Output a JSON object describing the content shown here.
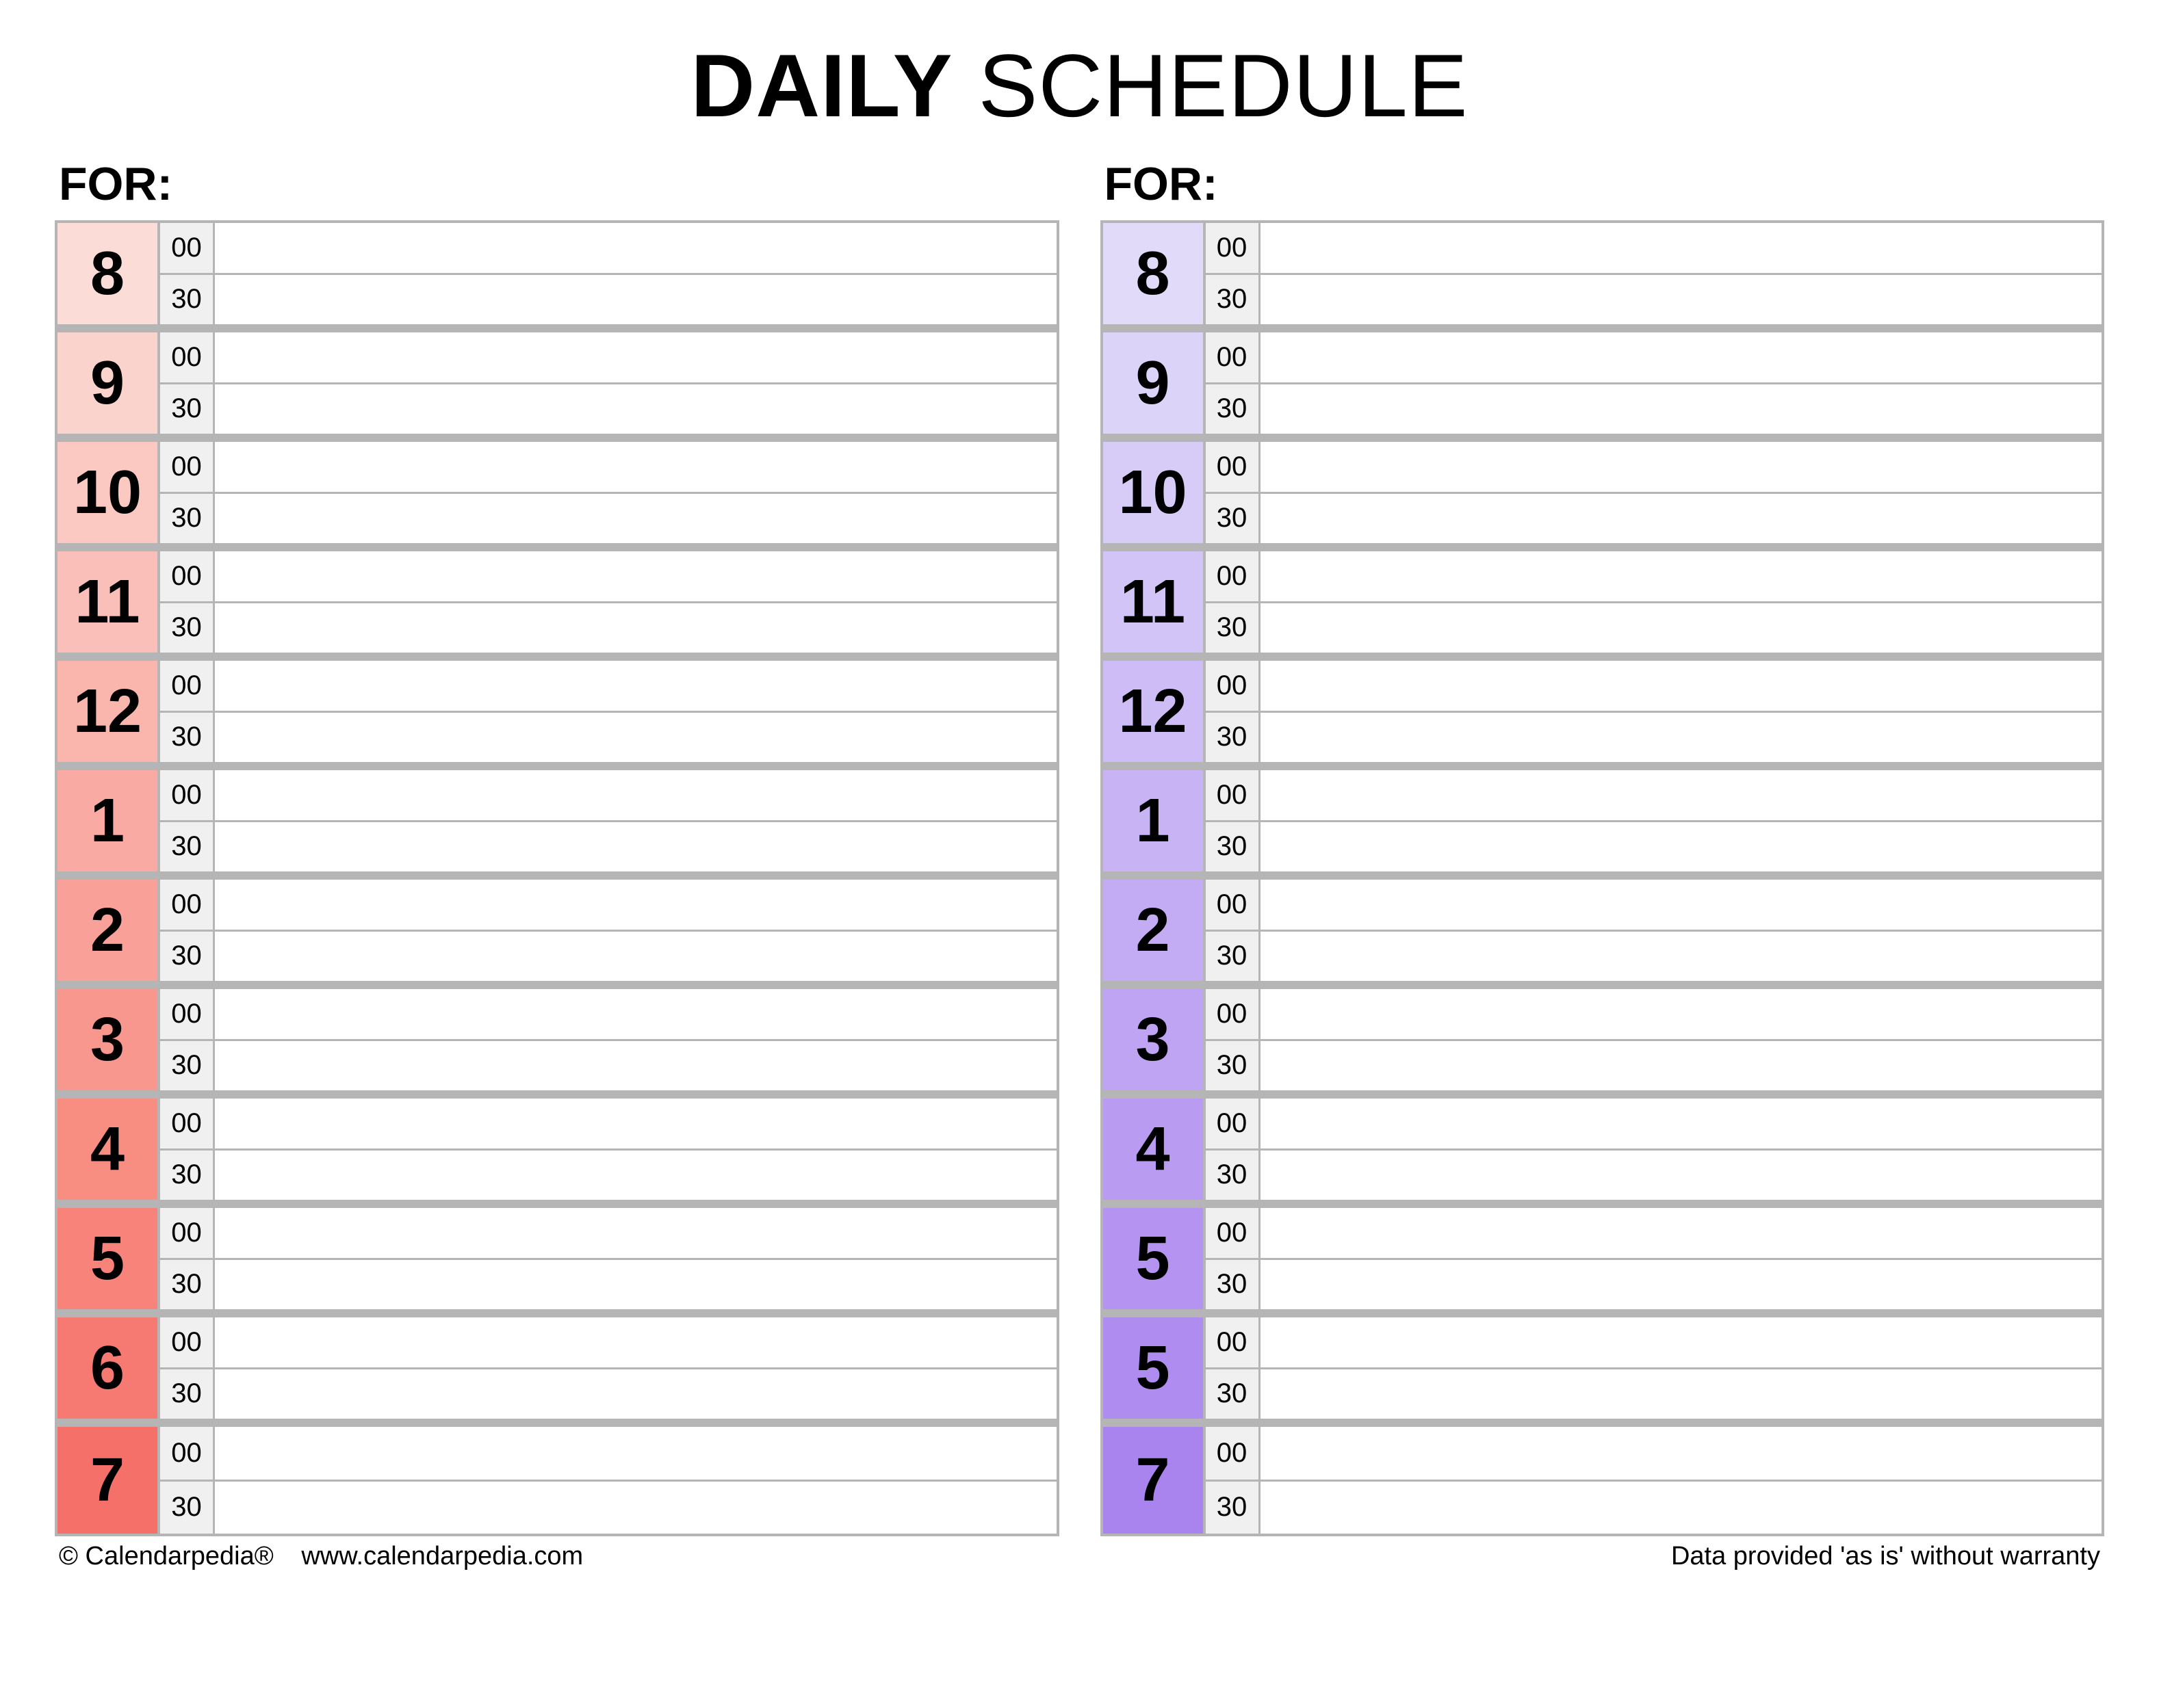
{
  "title": {
    "bold": "DAILY",
    "light": "SCHEDULE"
  },
  "for_label": "FOR:",
  "minutes": [
    "00",
    "30"
  ],
  "columns": [
    {
      "hours": [
        {
          "label": "8",
          "color": "#fcdcd6"
        },
        {
          "label": "9",
          "color": "#fbd3cd"
        },
        {
          "label": "10",
          "color": "#fbc9c2"
        },
        {
          "label": "11",
          "color": "#fabfb8"
        },
        {
          "label": "12",
          "color": "#fab5ad"
        },
        {
          "label": "1",
          "color": "#f9aba3"
        },
        {
          "label": "2",
          "color": "#f9a198"
        },
        {
          "label": "3",
          "color": "#f8978d"
        },
        {
          "label": "4",
          "color": "#f88d82"
        },
        {
          "label": "5",
          "color": "#f7837a"
        },
        {
          "label": "6",
          "color": "#f77a72"
        },
        {
          "label": "7",
          "color": "#f6706a"
        }
      ]
    },
    {
      "hours": [
        {
          "label": "8",
          "color": "#e1dbf9"
        },
        {
          "label": "9",
          "color": "#dcd4f8"
        },
        {
          "label": "10",
          "color": "#d7ccf7"
        },
        {
          "label": "11",
          "color": "#d2c4f6"
        },
        {
          "label": "12",
          "color": "#cdbcf5"
        },
        {
          "label": "1",
          "color": "#c8b4f4"
        },
        {
          "label": "2",
          "color": "#c3acf3"
        },
        {
          "label": "3",
          "color": "#bea4f2"
        },
        {
          "label": "4",
          "color": "#b99cf1"
        },
        {
          "label": "5",
          "color": "#b494f0"
        },
        {
          "label": "5",
          "color": "#af8cef"
        },
        {
          "label": "7",
          "color": "#aa84ee"
        }
      ]
    }
  ],
  "footer": {
    "copyright": "© Calendarpedia®",
    "url": "www.calendarpedia.com",
    "disclaimer": "Data provided 'as is' without warranty"
  }
}
